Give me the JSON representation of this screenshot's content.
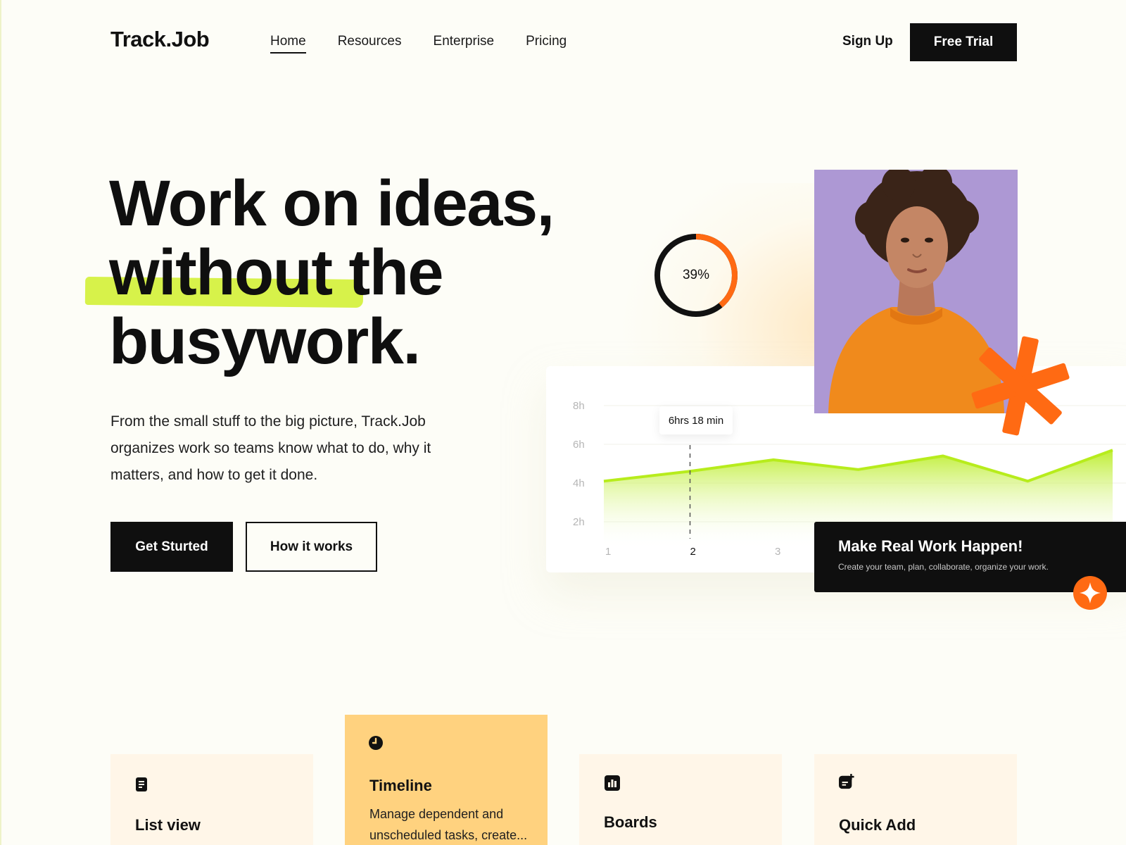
{
  "brand": {
    "logo": "Track.Job"
  },
  "nav": {
    "items": [
      {
        "label": "Home",
        "active": true
      },
      {
        "label": "Resources",
        "active": false
      },
      {
        "label": "Enterprise",
        "active": false
      },
      {
        "label": "Pricing",
        "active": false
      }
    ],
    "sign_up": "Sign Up",
    "free_trial": "Free Trial"
  },
  "hero": {
    "title_lines": [
      "Work on ideas,",
      "without",
      " the",
      "busywork."
    ],
    "description": "From the small stuff to the big picture, Track.Job organizes work so teams know what to do, why it matters, and how to get it done.",
    "primary_button": "Get Sturted",
    "secondary_button": "How it works",
    "highlight_color": "#d7f24a"
  },
  "progress": {
    "value_label": "39%",
    "value": 0.39,
    "color": "#ff6a13"
  },
  "chart_data": {
    "type": "area",
    "y_tick_labels": [
      "8h",
      "6h",
      "4h",
      "2h"
    ],
    "x_tick_labels": [
      "1",
      "2",
      "3"
    ],
    "ylim": [
      2,
      8
    ],
    "x": [
      1,
      2,
      3,
      4,
      5,
      6,
      7
    ],
    "values": [
      4.1,
      4.6,
      5.2,
      4.7,
      5.4,
      4.1,
      5.7
    ],
    "highlight": {
      "x": 2,
      "label": "6hrs 18 min"
    },
    "series_color": "#b7ec1c"
  },
  "promo": {
    "title": "Make Real Work Happen!",
    "subtitle": "Create your team, plan, collaborate, organize your work."
  },
  "colors": {
    "accent_orange": "#ff6a13",
    "accent_lime": "#d7f24a",
    "card_bg": "#fff6e8",
    "card_active_bg": "#ffd27f",
    "photo_bg": "#ad98d4"
  },
  "features": [
    {
      "icon": "list-icon",
      "title": "List view",
      "description": ""
    },
    {
      "icon": "clock-icon",
      "title": "Timeline",
      "description": "Manage dependent and unscheduled tasks, create..."
    },
    {
      "icon": "bar-chart-icon",
      "title": "Boards",
      "description": ""
    },
    {
      "icon": "note-add-icon",
      "title": "Quick Add",
      "description": ""
    }
  ]
}
